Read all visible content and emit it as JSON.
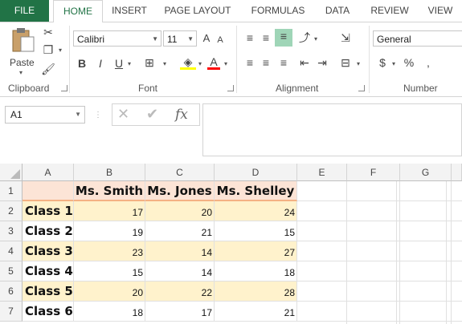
{
  "tabs": [
    "FILE",
    "HOME",
    "INSERT",
    "PAGE LAYOUT",
    "FORMULAS",
    "DATA",
    "REVIEW",
    "VIEW"
  ],
  "ribbon": {
    "clipboard": {
      "paste_label": "Paste",
      "group_label": "Clipboard"
    },
    "font": {
      "font_name": "Calibri",
      "font_size": "11",
      "bold": "B",
      "italic": "I",
      "underline": "U",
      "grow": "A",
      "shrink": "A",
      "font_color": "A",
      "group_label": "Font"
    },
    "alignment": {
      "group_label": "Alignment"
    },
    "number": {
      "format": "General",
      "currency": "$",
      "percent": "%",
      "group_label": "Number"
    }
  },
  "formula_bar": {
    "name_box": "A1",
    "fx": "fx",
    "value": ""
  },
  "columns": [
    "A",
    "B",
    "C",
    "D",
    "E",
    "F",
    "G"
  ],
  "rows": [
    "1",
    "2",
    "3",
    "4",
    "5",
    "6",
    "7"
  ],
  "colors": {
    "file_tab": "#217346",
    "header_fill": "#fce4d6",
    "band_fill": "#fff2cc",
    "header_border": "#f4b183"
  },
  "table": {
    "headers": [
      "Ms. Smith",
      "Ms. Jones",
      "Ms. Shelley"
    ],
    "rows": [
      {
        "label": "Class 1",
        "values": [
          "17",
          "20",
          "24"
        ]
      },
      {
        "label": "Class 2",
        "values": [
          "19",
          "21",
          "15"
        ]
      },
      {
        "label": "Class 3",
        "values": [
          "23",
          "14",
          "27"
        ]
      },
      {
        "label": "Class 4",
        "values": [
          "15",
          "14",
          "18"
        ]
      },
      {
        "label": "Class 5",
        "values": [
          "20",
          "22",
          "28"
        ]
      },
      {
        "label": "Class 6",
        "values": [
          "18",
          "17",
          "21"
        ]
      }
    ]
  }
}
